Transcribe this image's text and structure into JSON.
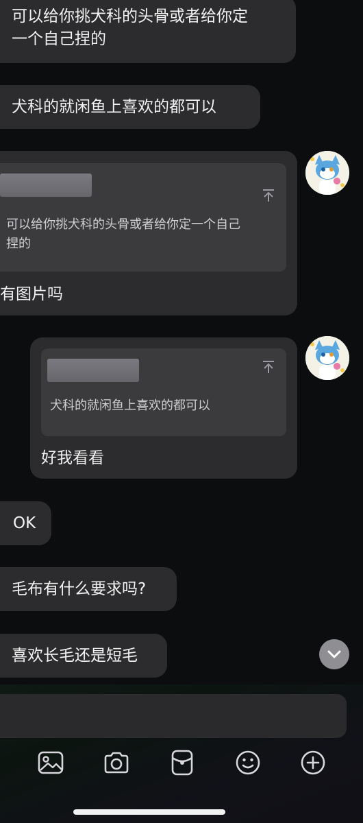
{
  "messages": [
    {
      "side": "left",
      "text_lines": [
        "可以给你挑犬科的头骨或者给你定",
        "一个自己捏的"
      ]
    },
    {
      "side": "left",
      "text": "犬科的就闲鱼上喜欢的都可以"
    },
    {
      "side": "right",
      "quote_lines": [
        "可以给你挑犬科的头骨或者给你定一个自己",
        "捏的"
      ],
      "text": "有图片吗",
      "avatar": "furry-avatar"
    },
    {
      "side": "right",
      "quote": "犬科的就闲鱼上喜欢的都可以",
      "text": "好我看看",
      "avatar": "furry-avatar"
    },
    {
      "side": "left",
      "text": "OK"
    },
    {
      "side": "left",
      "text": "毛布有什么要求吗?"
    },
    {
      "side": "left",
      "text": "喜欢长毛还是短毛"
    }
  ],
  "input": {
    "placeholder": ""
  },
  "toolbar": {
    "icons": [
      "image-icon",
      "camera-icon",
      "red-packet-icon",
      "emoji-icon",
      "plus-icon"
    ]
  },
  "scroll_button": {
    "icon": "chevron-down-icon"
  },
  "colors": {
    "bubble": "#2c2c2e",
    "quote": "#3b3b3e",
    "background": "#0c0d0f"
  }
}
